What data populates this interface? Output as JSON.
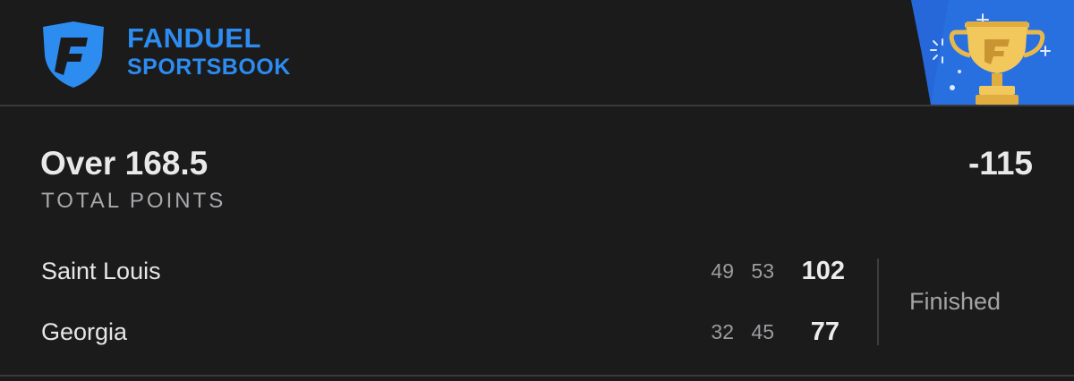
{
  "brand": {
    "name_top": "FANDUEL",
    "name_bottom": "SPORTSBOOK",
    "logo_icon": "fanduel-shield-icon",
    "badge_icon": "trophy-icon",
    "accent_color": "#2d8cf0"
  },
  "bet": {
    "selection": "Over 168.5",
    "market": "TOTAL POINTS",
    "odds": "-115"
  },
  "game": {
    "teams": [
      {
        "name": "Saint Louis",
        "period_scores": [
          "49",
          "53"
        ],
        "total": "102"
      },
      {
        "name": "Georgia",
        "period_scores": [
          "32",
          "45"
        ],
        "total": "77"
      }
    ],
    "status": "Finished"
  }
}
